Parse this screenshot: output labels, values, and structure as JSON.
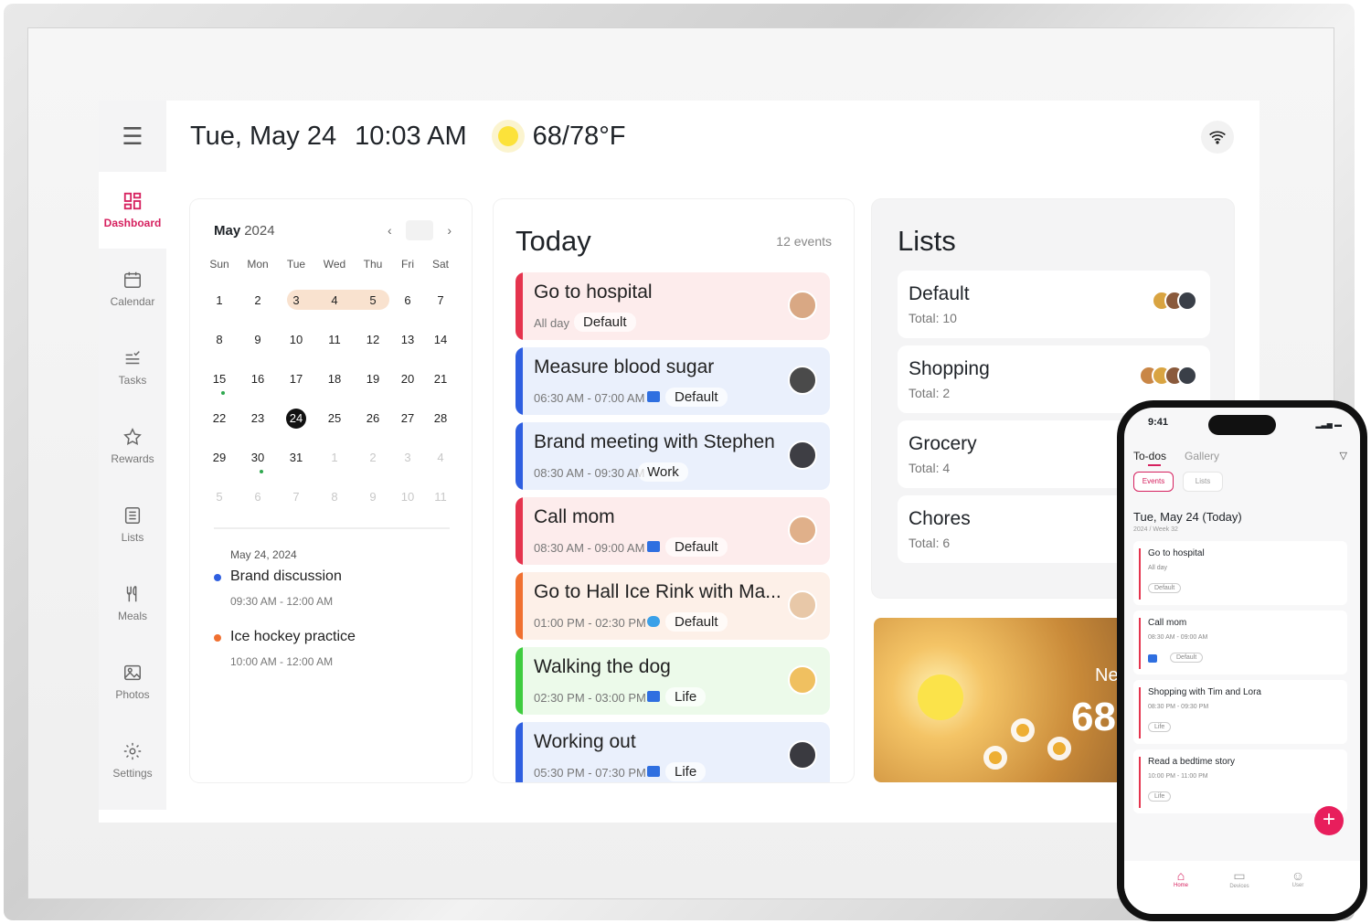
{
  "header": {
    "date": "Tue, May 24",
    "time": "10:03 AM",
    "temperature": "68/78°F",
    "weather_icon": "sun-icon",
    "wifi_icon": "wifi-icon"
  },
  "sidebar": {
    "items": [
      {
        "label": "Dashboard",
        "icon": "dashboard-icon",
        "active": true
      },
      {
        "label": "Calendar",
        "icon": "calendar-icon"
      },
      {
        "label": "Tasks",
        "icon": "tasks-icon"
      },
      {
        "label": "Rewards",
        "icon": "star-icon"
      },
      {
        "label": "Lists",
        "icon": "list-icon"
      },
      {
        "label": "Meals",
        "icon": "utensils-icon"
      },
      {
        "label": "Photos",
        "icon": "image-icon"
      },
      {
        "label": "Settings",
        "icon": "gear-icon"
      }
    ]
  },
  "calendar": {
    "month": "May",
    "year": "2024",
    "weekdays": [
      "Sun",
      "Mon",
      "Tue",
      "Wed",
      "Thu",
      "Fri",
      "Sat"
    ],
    "weeks": [
      [
        "1",
        "2",
        "3",
        "4",
        "5",
        "6",
        "7"
      ],
      [
        "8",
        "9",
        "10",
        "11",
        "12",
        "13",
        "14"
      ],
      [
        "15",
        "16",
        "17",
        "18",
        "19",
        "20",
        "21"
      ],
      [
        "22",
        "23",
        "24",
        "25",
        "26",
        "27",
        "28"
      ],
      [
        "29",
        "30",
        "31",
        "1",
        "2",
        "3",
        "4"
      ],
      [
        "5",
        "6",
        "7",
        "8",
        "9",
        "10",
        "11"
      ]
    ],
    "selected_day": "24",
    "agenda_date": "May 24, 2024",
    "agenda": [
      {
        "title": "Brand discussion",
        "time": "09:30 AM - 12:00 AM",
        "color": "#2f5fe0"
      },
      {
        "title": "Ice hockey practice",
        "time": "10:00 AM - 12:00 AM",
        "color": "#f07030"
      }
    ]
  },
  "today": {
    "title": "Today",
    "count": "12 events",
    "events": [
      {
        "title": "Go to hospital",
        "time": "All day",
        "tag": "Default",
        "bar": "#e5344e",
        "bg": "#fdecec",
        "source_icon": ""
      },
      {
        "title": "Measure blood sugar",
        "time": "06:30 AM - 07:00 AM",
        "tag": "Default",
        "bar": "#2f5fe0",
        "bg": "#eaf0fc",
        "source_icon": "google-calendar-icon"
      },
      {
        "title": "Brand meeting with Stephen",
        "time": "08:30 AM - 09:30 AM",
        "tag": "Work",
        "bar": "#2f5fe0",
        "bg": "#eaf0fc",
        "source_icon": ""
      },
      {
        "title": "Call mom",
        "time": "08:30 AM - 09:00 AM",
        "tag": "Default",
        "bar": "#e5344e",
        "bg": "#fdecec",
        "source_icon": "outlook-icon"
      },
      {
        "title": "Go to Hall Ice Rink with Ma...",
        "time": "01:00 PM - 02:30 PM",
        "tag": "Default",
        "bar": "#f07030",
        "bg": "#fdf0e8",
        "source_icon": "cloud-icon"
      },
      {
        "title": "Walking the dog",
        "time": "02:30 PM - 03:00 PM",
        "tag": "Life",
        "bar": "#3fcc3f",
        "bg": "#ecfaea",
        "source_icon": "google-calendar-icon"
      },
      {
        "title": "Working out",
        "time": "05:30 PM - 07:30 PM",
        "tag": "Life",
        "bar": "#2f5fe0",
        "bg": "#eaf0fc",
        "source_icon": "outlook-icon"
      }
    ]
  },
  "lists": {
    "title": "Lists",
    "items": [
      {
        "name": "Default",
        "total_label": "Total:",
        "total": "10"
      },
      {
        "name": "Shopping",
        "total_label": "Total:",
        "total": "2"
      },
      {
        "name": "Grocery",
        "total_label": "Total:",
        "total": "4"
      },
      {
        "name": "Chores",
        "total_label": "Total:",
        "total": "6"
      }
    ]
  },
  "photo": {
    "caption_line1": "Ne",
    "caption_line2": "68"
  },
  "phone": {
    "clock": "9:41",
    "tabs": [
      "To-dos",
      "Gallery"
    ],
    "pills": [
      "Events",
      "Lists"
    ],
    "date": "Tue, May 24 (Today)",
    "week": "2024 / Week 32",
    "events": [
      {
        "title": "Go to hospital",
        "time": "All day",
        "tag": "Default",
        "bar": "#e5344e"
      },
      {
        "title": "Call mom",
        "time": "08:30 AM - 09:00 AM",
        "tag": "Default",
        "bar": "#e5344e"
      },
      {
        "title": "Shopping with Tim and Lora",
        "time": "08:30 PM - 09:30 PM",
        "tag": "Life",
        "bar": "#e5344e"
      },
      {
        "title": "Read a bedtime story",
        "time": "10:00 PM - 11:00 PM",
        "tag": "Life",
        "bar": "#e5344e"
      }
    ],
    "fab": "+",
    "nav": [
      "Home",
      "Devices",
      "User"
    ]
  },
  "colors": {
    "accent": "#d6215f"
  }
}
